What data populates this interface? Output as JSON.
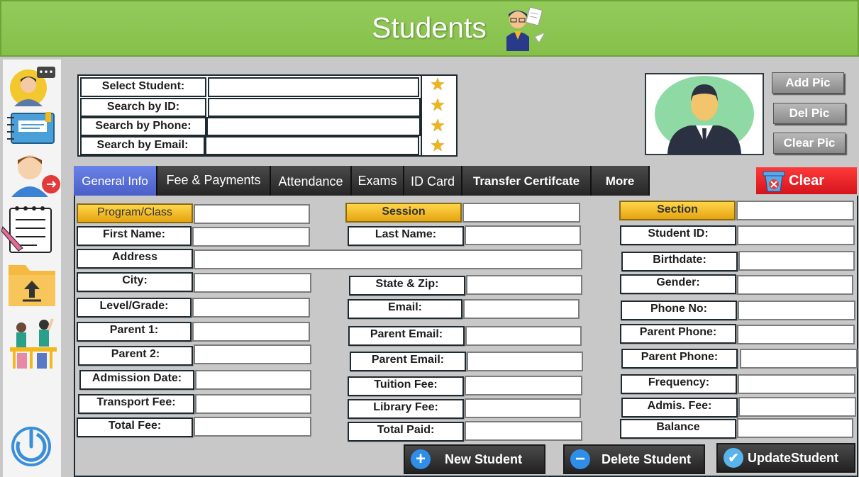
{
  "header": {
    "title": "Students",
    "bg_color": "#8bc34a"
  },
  "search": {
    "rows": [
      {
        "label": "Select Student:",
        "value": ""
      },
      {
        "label": "Search by ID:",
        "value": ""
      },
      {
        "label": "Search by Phone:",
        "value": ""
      },
      {
        "label": "Search by Email:",
        "value": ""
      }
    ]
  },
  "photo": {
    "add_label": "Add Pic",
    "del_label": "Del Pic",
    "clear_label": "Clear Pic"
  },
  "tabs": [
    "General Info",
    "Fee & Payments",
    "Attendance",
    "Exams",
    "ID Card",
    "Transfer Certifcate",
    "More"
  ],
  "clear_button": "Clear",
  "form": {
    "col1": [
      {
        "label": "Program/Class",
        "value": ""
      },
      {
        "label": "First Name:",
        "value": ""
      },
      {
        "label": "Address",
        "value": ""
      },
      {
        "label": "City:",
        "value": ""
      },
      {
        "label": "Level/Grade:",
        "value": ""
      },
      {
        "label": "Parent 1:",
        "value": ""
      },
      {
        "label": "Parent 2:",
        "value": ""
      },
      {
        "label": "Admission Date:",
        "value": ""
      },
      {
        "label": "Transport Fee:",
        "value": ""
      },
      {
        "label": "Total Fee:",
        "value": ""
      }
    ],
    "col2": [
      {
        "label": "Session",
        "value": ""
      },
      {
        "label": "Last Name:",
        "value": ""
      },
      {
        "label": "State & Zip:",
        "value": ""
      },
      {
        "label": "Email:",
        "value": ""
      },
      {
        "label": "Parent Email:",
        "value": ""
      },
      {
        "label": "Parent Email:",
        "value": ""
      },
      {
        "label": "Tuition Fee:",
        "value": ""
      },
      {
        "label": "Library Fee:",
        "value": ""
      },
      {
        "label": "Total Paid:",
        "value": ""
      }
    ],
    "col3": [
      {
        "label": "Section",
        "value": ""
      },
      {
        "label": "Student ID:",
        "value": ""
      },
      {
        "label": "Birthdate:",
        "value": ""
      },
      {
        "label": "Gender:",
        "value": ""
      },
      {
        "label": "Phone No:",
        "value": ""
      },
      {
        "label": "Parent Phone:",
        "value": ""
      },
      {
        "label": "Parent Phone:",
        "value": ""
      },
      {
        "label": "Frequency:",
        "value": ""
      },
      {
        "label": "Admis. Fee:",
        "value": ""
      },
      {
        "label": "Balance",
        "value": ""
      }
    ]
  },
  "actions": {
    "new_student": "New Student",
    "delete_student": "Delete Student",
    "update_student": "UpdateStudent"
  },
  "sidebar_icons": [
    "support-agent-icon",
    "notebook-icon",
    "user-logout-icon",
    "notepad-icon",
    "upload-folder-icon",
    "classroom-icon",
    "power-icon"
  ],
  "colors": {
    "active_tab": "#5b6fd6",
    "gold": "#f2b81c",
    "clear_red": "#e8202a",
    "tab_dark": "#2b2b2b"
  }
}
